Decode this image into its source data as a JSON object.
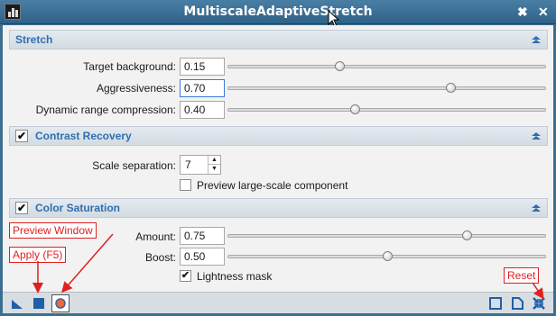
{
  "window": {
    "title": "MultiscaleAdaptiveStretch",
    "pin_symbol": "✖",
    "close_symbol": "✕"
  },
  "stretch": {
    "header": "Stretch",
    "target_background": {
      "label": "Target background:",
      "value": "0.15",
      "slider": 0.35
    },
    "aggressiveness": {
      "label": "Aggressiveness:",
      "value": "0.70",
      "slider": 0.7
    },
    "drc": {
      "label": "Dynamic range compression:",
      "value": "0.40",
      "slider": 0.4
    }
  },
  "contrast_recovery": {
    "header": "Contrast Recovery",
    "enabled_mark": "✔",
    "scale_separation": {
      "label": "Scale separation:",
      "value": "7",
      "up": "▲",
      "down": "▼"
    },
    "preview_large_scale": {
      "label": "Preview large-scale component",
      "checked": false
    }
  },
  "color_saturation": {
    "header": "Color Saturation",
    "enabled_mark": "✔",
    "amount": {
      "label": "Amount:",
      "value": "0.75",
      "slider": 0.75
    },
    "boost": {
      "label": "Boost:",
      "value": "0.50",
      "slider": 0.5
    },
    "lightness_mask": {
      "label": "Lightness mask",
      "checked": true,
      "mark": "✔"
    }
  },
  "annotations": {
    "preview_window": "Preview Window",
    "apply": "Apply (F5)",
    "reset": "Reset"
  },
  "colors": {
    "accent": "#2f6fae",
    "annotation": "#e02020",
    "titlebar": "#3b6e8f"
  }
}
